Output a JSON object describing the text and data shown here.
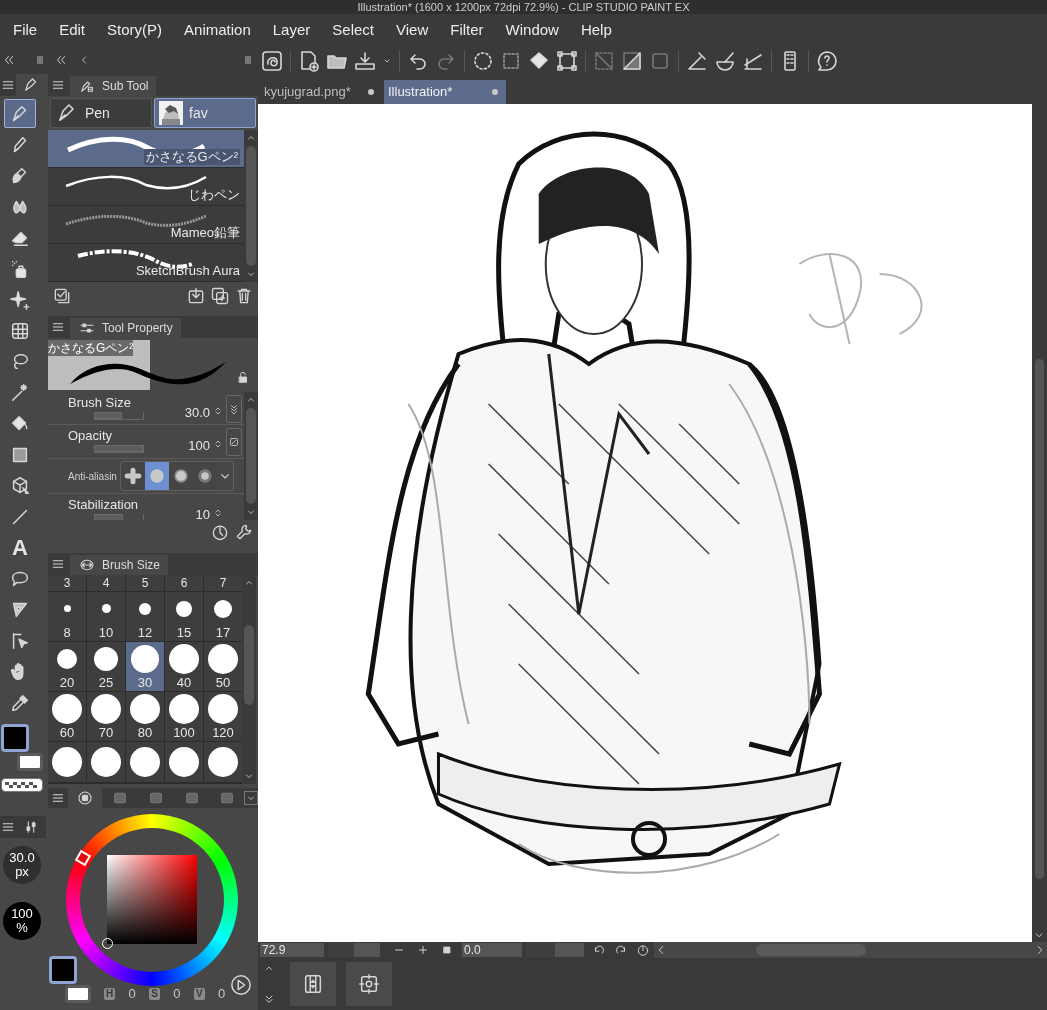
{
  "window": {
    "title": "Illustration* (1600 x 1200px 72dpi 72.9%) - CLIP STUDIO PAINT EX"
  },
  "menu": [
    "File",
    "Edit",
    "Story(P)",
    "Animation",
    "Layer",
    "Select",
    "View",
    "Filter",
    "Window",
    "Help"
  ],
  "document_tabs": [
    {
      "label": "kyujugrad.png*",
      "selected": false
    },
    {
      "label": "Illustration*",
      "selected": true
    }
  ],
  "tools": [
    {
      "selected": true
    },
    {
      "selected": false
    },
    {
      "selected": false
    },
    {
      "selected": false
    },
    {
      "selected": false
    },
    {
      "selected": false
    },
    {
      "selected": false
    },
    {
      "selected": false
    },
    {
      "selected": false
    },
    {
      "selected": false
    },
    {
      "selected": false
    },
    {
      "selected": false
    },
    {
      "selected": false
    },
    {
      "selected": false
    },
    {
      "glyph": "A",
      "selected": false
    },
    {
      "selected": false
    },
    {
      "selected": false
    },
    {
      "selected": false
    },
    {
      "selected": false
    },
    {
      "selected": false
    }
  ],
  "tool_colors": [
    {
      "color": "#000000",
      "selected": true
    },
    {
      "color": "#ffffff",
      "selected": false
    }
  ],
  "quick_readouts": [
    {
      "value": "30.0",
      "unit": "px"
    },
    {
      "value": "100",
      "unit": "%"
    }
  ],
  "sub_tool": {
    "title": "Sub Tool",
    "groups": [
      {
        "label": "Pen",
        "selected": false
      },
      {
        "label": "fav",
        "selected": true
      }
    ],
    "brushes": [
      {
        "name": "かさなるGペン²",
        "selected": true
      },
      {
        "name": "じわペン",
        "selected": false
      },
      {
        "name": "Mameo鉛筆",
        "selected": false
      },
      {
        "name": "SketchBrush Aura",
        "selected": false
      }
    ]
  },
  "tool_property": {
    "title": "Tool Property",
    "preview_label": "かさなるGペン²",
    "properties": [
      {
        "kind": "slider",
        "label": "Brush Size",
        "value": "30.0",
        "level": 0.58
      },
      {
        "kind": "slider",
        "label": "Opacity",
        "value": "100",
        "level": 1
      },
      {
        "kind": "options",
        "label": "Anti-aliasin",
        "options": [
          {
            "selected": false
          },
          {
            "selected": true
          },
          {
            "selected": false
          },
          {
            "selected": false
          }
        ]
      },
      {
        "kind": "slider",
        "label": "Stabilization",
        "value": "10",
        "level": 0.6
      }
    ]
  },
  "brush_size": {
    "title": "Brush Size",
    "top_labels": [
      "3",
      "4",
      "5",
      "6",
      "7"
    ],
    "cells": [
      {
        "label": "8",
        "selected": false
      },
      {
        "label": "10",
        "selected": false
      },
      {
        "label": "12",
        "selected": false
      },
      {
        "label": "15",
        "selected": false
      },
      {
        "label": "17",
        "selected": false
      },
      {
        "label": "20",
        "selected": false
      },
      {
        "label": "25",
        "selected": false
      },
      {
        "label": "30",
        "selected": true
      },
      {
        "label": "40",
        "selected": false
      },
      {
        "label": "50",
        "selected": false
      },
      {
        "label": "60",
        "selected": false
      },
      {
        "label": "70",
        "selected": false
      },
      {
        "label": "80",
        "selected": false
      },
      {
        "label": "100",
        "selected": false
      },
      {
        "label": "120",
        "selected": false
      },
      {
        "selected": false
      },
      {
        "selected": false
      },
      {
        "selected": false
      },
      {
        "selected": false
      },
      {
        "selected": false
      }
    ]
  },
  "color_wheel": {
    "tabs": [
      {
        "selected": true
      },
      {
        "selected": false
      },
      {
        "selected": false
      },
      {
        "selected": false
      },
      {
        "selected": false
      }
    ],
    "colors": [
      {
        "color": "#000000",
        "selected": true
      },
      {
        "color": "#ffffff",
        "selected": false
      }
    ],
    "hsv": [
      {
        "label": "H",
        "value": "0"
      },
      {
        "label": "S",
        "value": "0"
      },
      {
        "label": "V",
        "value": "0"
      }
    ]
  },
  "status_bar": {
    "zoom": "72.9",
    "zoom_slider": {
      "level": 0.5
    },
    "rotation": "0.0",
    "rotation_slider": {
      "level": 0.5
    }
  }
}
